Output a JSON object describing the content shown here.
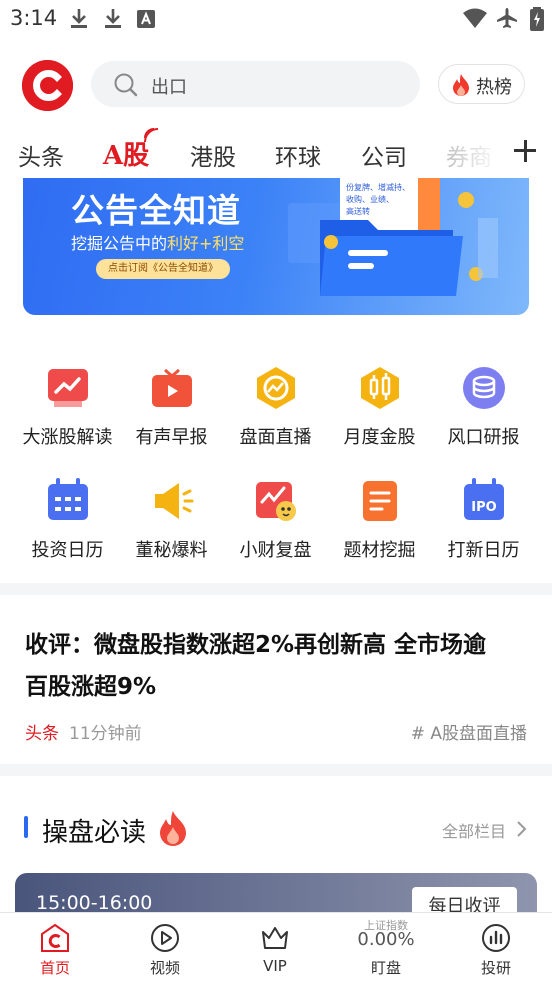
{
  "status_bar": {
    "time": "3:14"
  },
  "header": {
    "search_placeholder": "出口",
    "hot_label": "热榜"
  },
  "tabs": [
    {
      "label": "头条"
    },
    {
      "label": "A股"
    },
    {
      "label": "港股"
    },
    {
      "label": "环球"
    },
    {
      "label": "公司"
    },
    {
      "label": "券商"
    }
  ],
  "banner": {
    "title": "公告全知道",
    "subtitle_prefix": "挖掘公告中的",
    "subtitle_highlight": "利好+利空",
    "button": "点击订阅《公告全知道》",
    "tags": [
      "份复牌、增减持、",
      "收购、业绩、",
      "高送转"
    ]
  },
  "grid": [
    {
      "label": "大涨股解读",
      "icon": "chart-up-icon"
    },
    {
      "label": "有声早报",
      "icon": "tv-icon"
    },
    {
      "label": "盘面直播",
      "icon": "live-chart-icon"
    },
    {
      "label": "月度金股",
      "icon": "candlestick-icon"
    },
    {
      "label": "风口研报",
      "icon": "coins-icon"
    },
    {
      "label": "投资日历",
      "icon": "calendar-icon"
    },
    {
      "label": "董秘爆料",
      "icon": "megaphone-icon"
    },
    {
      "label": "小财复盘",
      "icon": "mascot-icon"
    },
    {
      "label": "题材挖掘",
      "icon": "document-icon"
    },
    {
      "label": "打新日历",
      "icon": "ipo-calendar-icon"
    }
  ],
  "article": {
    "title_line1": "收评：微盘股指数涨超2%再创新高 全市场逾",
    "title_line2": "百股涨超9%",
    "category": "头条",
    "time_ago": "11分钟前",
    "tag": "# A股盘面直播"
  },
  "section": {
    "title": "操盘必读",
    "more": "全部栏目",
    "card_time": "15:00-16:00",
    "card_button": "每日收评"
  },
  "bottom_nav": [
    {
      "label": "首页",
      "active": true
    },
    {
      "label": "视频"
    },
    {
      "label": "VIP"
    },
    {
      "label": "盯盘",
      "index_name": "上证指数",
      "index_value": "0.00%"
    },
    {
      "label": "投研"
    }
  ],
  "colors": {
    "brand": "#e11b22",
    "accent_blue": "#2b6af0"
  }
}
